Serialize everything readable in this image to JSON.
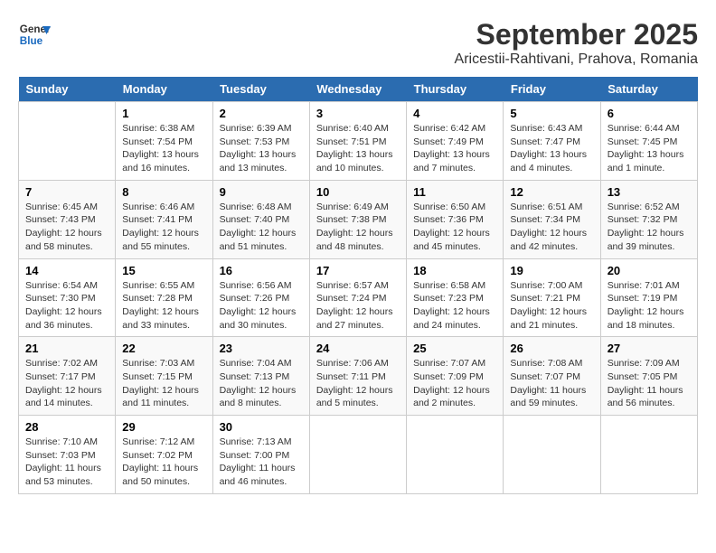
{
  "header": {
    "logo_line1": "General",
    "logo_line2": "Blue",
    "title": "September 2025",
    "subtitle": "Aricestii-Rahtivani, Prahova, Romania"
  },
  "weekdays": [
    "Sunday",
    "Monday",
    "Tuesday",
    "Wednesday",
    "Thursday",
    "Friday",
    "Saturday"
  ],
  "weeks": [
    [
      {
        "day": "",
        "lines": []
      },
      {
        "day": "1",
        "lines": [
          "Sunrise: 6:38 AM",
          "Sunset: 7:54 PM",
          "Daylight: 13 hours",
          "and 16 minutes."
        ]
      },
      {
        "day": "2",
        "lines": [
          "Sunrise: 6:39 AM",
          "Sunset: 7:53 PM",
          "Daylight: 13 hours",
          "and 13 minutes."
        ]
      },
      {
        "day": "3",
        "lines": [
          "Sunrise: 6:40 AM",
          "Sunset: 7:51 PM",
          "Daylight: 13 hours",
          "and 10 minutes."
        ]
      },
      {
        "day": "4",
        "lines": [
          "Sunrise: 6:42 AM",
          "Sunset: 7:49 PM",
          "Daylight: 13 hours",
          "and 7 minutes."
        ]
      },
      {
        "day": "5",
        "lines": [
          "Sunrise: 6:43 AM",
          "Sunset: 7:47 PM",
          "Daylight: 13 hours",
          "and 4 minutes."
        ]
      },
      {
        "day": "6",
        "lines": [
          "Sunrise: 6:44 AM",
          "Sunset: 7:45 PM",
          "Daylight: 13 hours",
          "and 1 minute."
        ]
      }
    ],
    [
      {
        "day": "7",
        "lines": [
          "Sunrise: 6:45 AM",
          "Sunset: 7:43 PM",
          "Daylight: 12 hours",
          "and 58 minutes."
        ]
      },
      {
        "day": "8",
        "lines": [
          "Sunrise: 6:46 AM",
          "Sunset: 7:41 PM",
          "Daylight: 12 hours",
          "and 55 minutes."
        ]
      },
      {
        "day": "9",
        "lines": [
          "Sunrise: 6:48 AM",
          "Sunset: 7:40 PM",
          "Daylight: 12 hours",
          "and 51 minutes."
        ]
      },
      {
        "day": "10",
        "lines": [
          "Sunrise: 6:49 AM",
          "Sunset: 7:38 PM",
          "Daylight: 12 hours",
          "and 48 minutes."
        ]
      },
      {
        "day": "11",
        "lines": [
          "Sunrise: 6:50 AM",
          "Sunset: 7:36 PM",
          "Daylight: 12 hours",
          "and 45 minutes."
        ]
      },
      {
        "day": "12",
        "lines": [
          "Sunrise: 6:51 AM",
          "Sunset: 7:34 PM",
          "Daylight: 12 hours",
          "and 42 minutes."
        ]
      },
      {
        "day": "13",
        "lines": [
          "Sunrise: 6:52 AM",
          "Sunset: 7:32 PM",
          "Daylight: 12 hours",
          "and 39 minutes."
        ]
      }
    ],
    [
      {
        "day": "14",
        "lines": [
          "Sunrise: 6:54 AM",
          "Sunset: 7:30 PM",
          "Daylight: 12 hours",
          "and 36 minutes."
        ]
      },
      {
        "day": "15",
        "lines": [
          "Sunrise: 6:55 AM",
          "Sunset: 7:28 PM",
          "Daylight: 12 hours",
          "and 33 minutes."
        ]
      },
      {
        "day": "16",
        "lines": [
          "Sunrise: 6:56 AM",
          "Sunset: 7:26 PM",
          "Daylight: 12 hours",
          "and 30 minutes."
        ]
      },
      {
        "day": "17",
        "lines": [
          "Sunrise: 6:57 AM",
          "Sunset: 7:24 PM",
          "Daylight: 12 hours",
          "and 27 minutes."
        ]
      },
      {
        "day": "18",
        "lines": [
          "Sunrise: 6:58 AM",
          "Sunset: 7:23 PM",
          "Daylight: 12 hours",
          "and 24 minutes."
        ]
      },
      {
        "day": "19",
        "lines": [
          "Sunrise: 7:00 AM",
          "Sunset: 7:21 PM",
          "Daylight: 12 hours",
          "and 21 minutes."
        ]
      },
      {
        "day": "20",
        "lines": [
          "Sunrise: 7:01 AM",
          "Sunset: 7:19 PM",
          "Daylight: 12 hours",
          "and 18 minutes."
        ]
      }
    ],
    [
      {
        "day": "21",
        "lines": [
          "Sunrise: 7:02 AM",
          "Sunset: 7:17 PM",
          "Daylight: 12 hours",
          "and 14 minutes."
        ]
      },
      {
        "day": "22",
        "lines": [
          "Sunrise: 7:03 AM",
          "Sunset: 7:15 PM",
          "Daylight: 12 hours",
          "and 11 minutes."
        ]
      },
      {
        "day": "23",
        "lines": [
          "Sunrise: 7:04 AM",
          "Sunset: 7:13 PM",
          "Daylight: 12 hours",
          "and 8 minutes."
        ]
      },
      {
        "day": "24",
        "lines": [
          "Sunrise: 7:06 AM",
          "Sunset: 7:11 PM",
          "Daylight: 12 hours",
          "and 5 minutes."
        ]
      },
      {
        "day": "25",
        "lines": [
          "Sunrise: 7:07 AM",
          "Sunset: 7:09 PM",
          "Daylight: 12 hours",
          "and 2 minutes."
        ]
      },
      {
        "day": "26",
        "lines": [
          "Sunrise: 7:08 AM",
          "Sunset: 7:07 PM",
          "Daylight: 11 hours",
          "and 59 minutes."
        ]
      },
      {
        "day": "27",
        "lines": [
          "Sunrise: 7:09 AM",
          "Sunset: 7:05 PM",
          "Daylight: 11 hours",
          "and 56 minutes."
        ]
      }
    ],
    [
      {
        "day": "28",
        "lines": [
          "Sunrise: 7:10 AM",
          "Sunset: 7:03 PM",
          "Daylight: 11 hours",
          "and 53 minutes."
        ]
      },
      {
        "day": "29",
        "lines": [
          "Sunrise: 7:12 AM",
          "Sunset: 7:02 PM",
          "Daylight: 11 hours",
          "and 50 minutes."
        ]
      },
      {
        "day": "30",
        "lines": [
          "Sunrise: 7:13 AM",
          "Sunset: 7:00 PM",
          "Daylight: 11 hours",
          "and 46 minutes."
        ]
      },
      {
        "day": "",
        "lines": []
      },
      {
        "day": "",
        "lines": []
      },
      {
        "day": "",
        "lines": []
      },
      {
        "day": "",
        "lines": []
      }
    ]
  ]
}
